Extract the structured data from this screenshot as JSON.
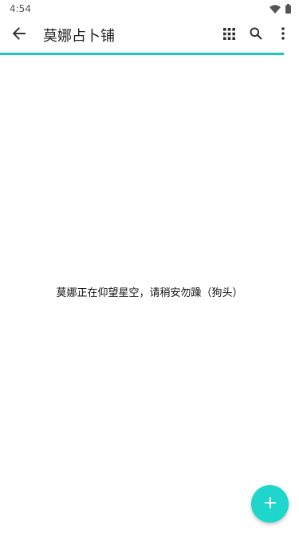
{
  "status_bar": {
    "time": "4:54",
    "icons": [
      "wifi-icon",
      "battery-icon"
    ]
  },
  "toolbar": {
    "title": "莫娜占卜铺",
    "back_icon": "arrow-back-icon",
    "actions": [
      "grid-icon",
      "search-icon",
      "more-vert-icon"
    ]
  },
  "main": {
    "message": "莫娜正在仰望星空，请稍安勿躁（狗头）"
  },
  "fab": {
    "icon": "plus-icon"
  },
  "colors": {
    "accent": "#1fc7c2",
    "fab": "#1fd6cc"
  }
}
